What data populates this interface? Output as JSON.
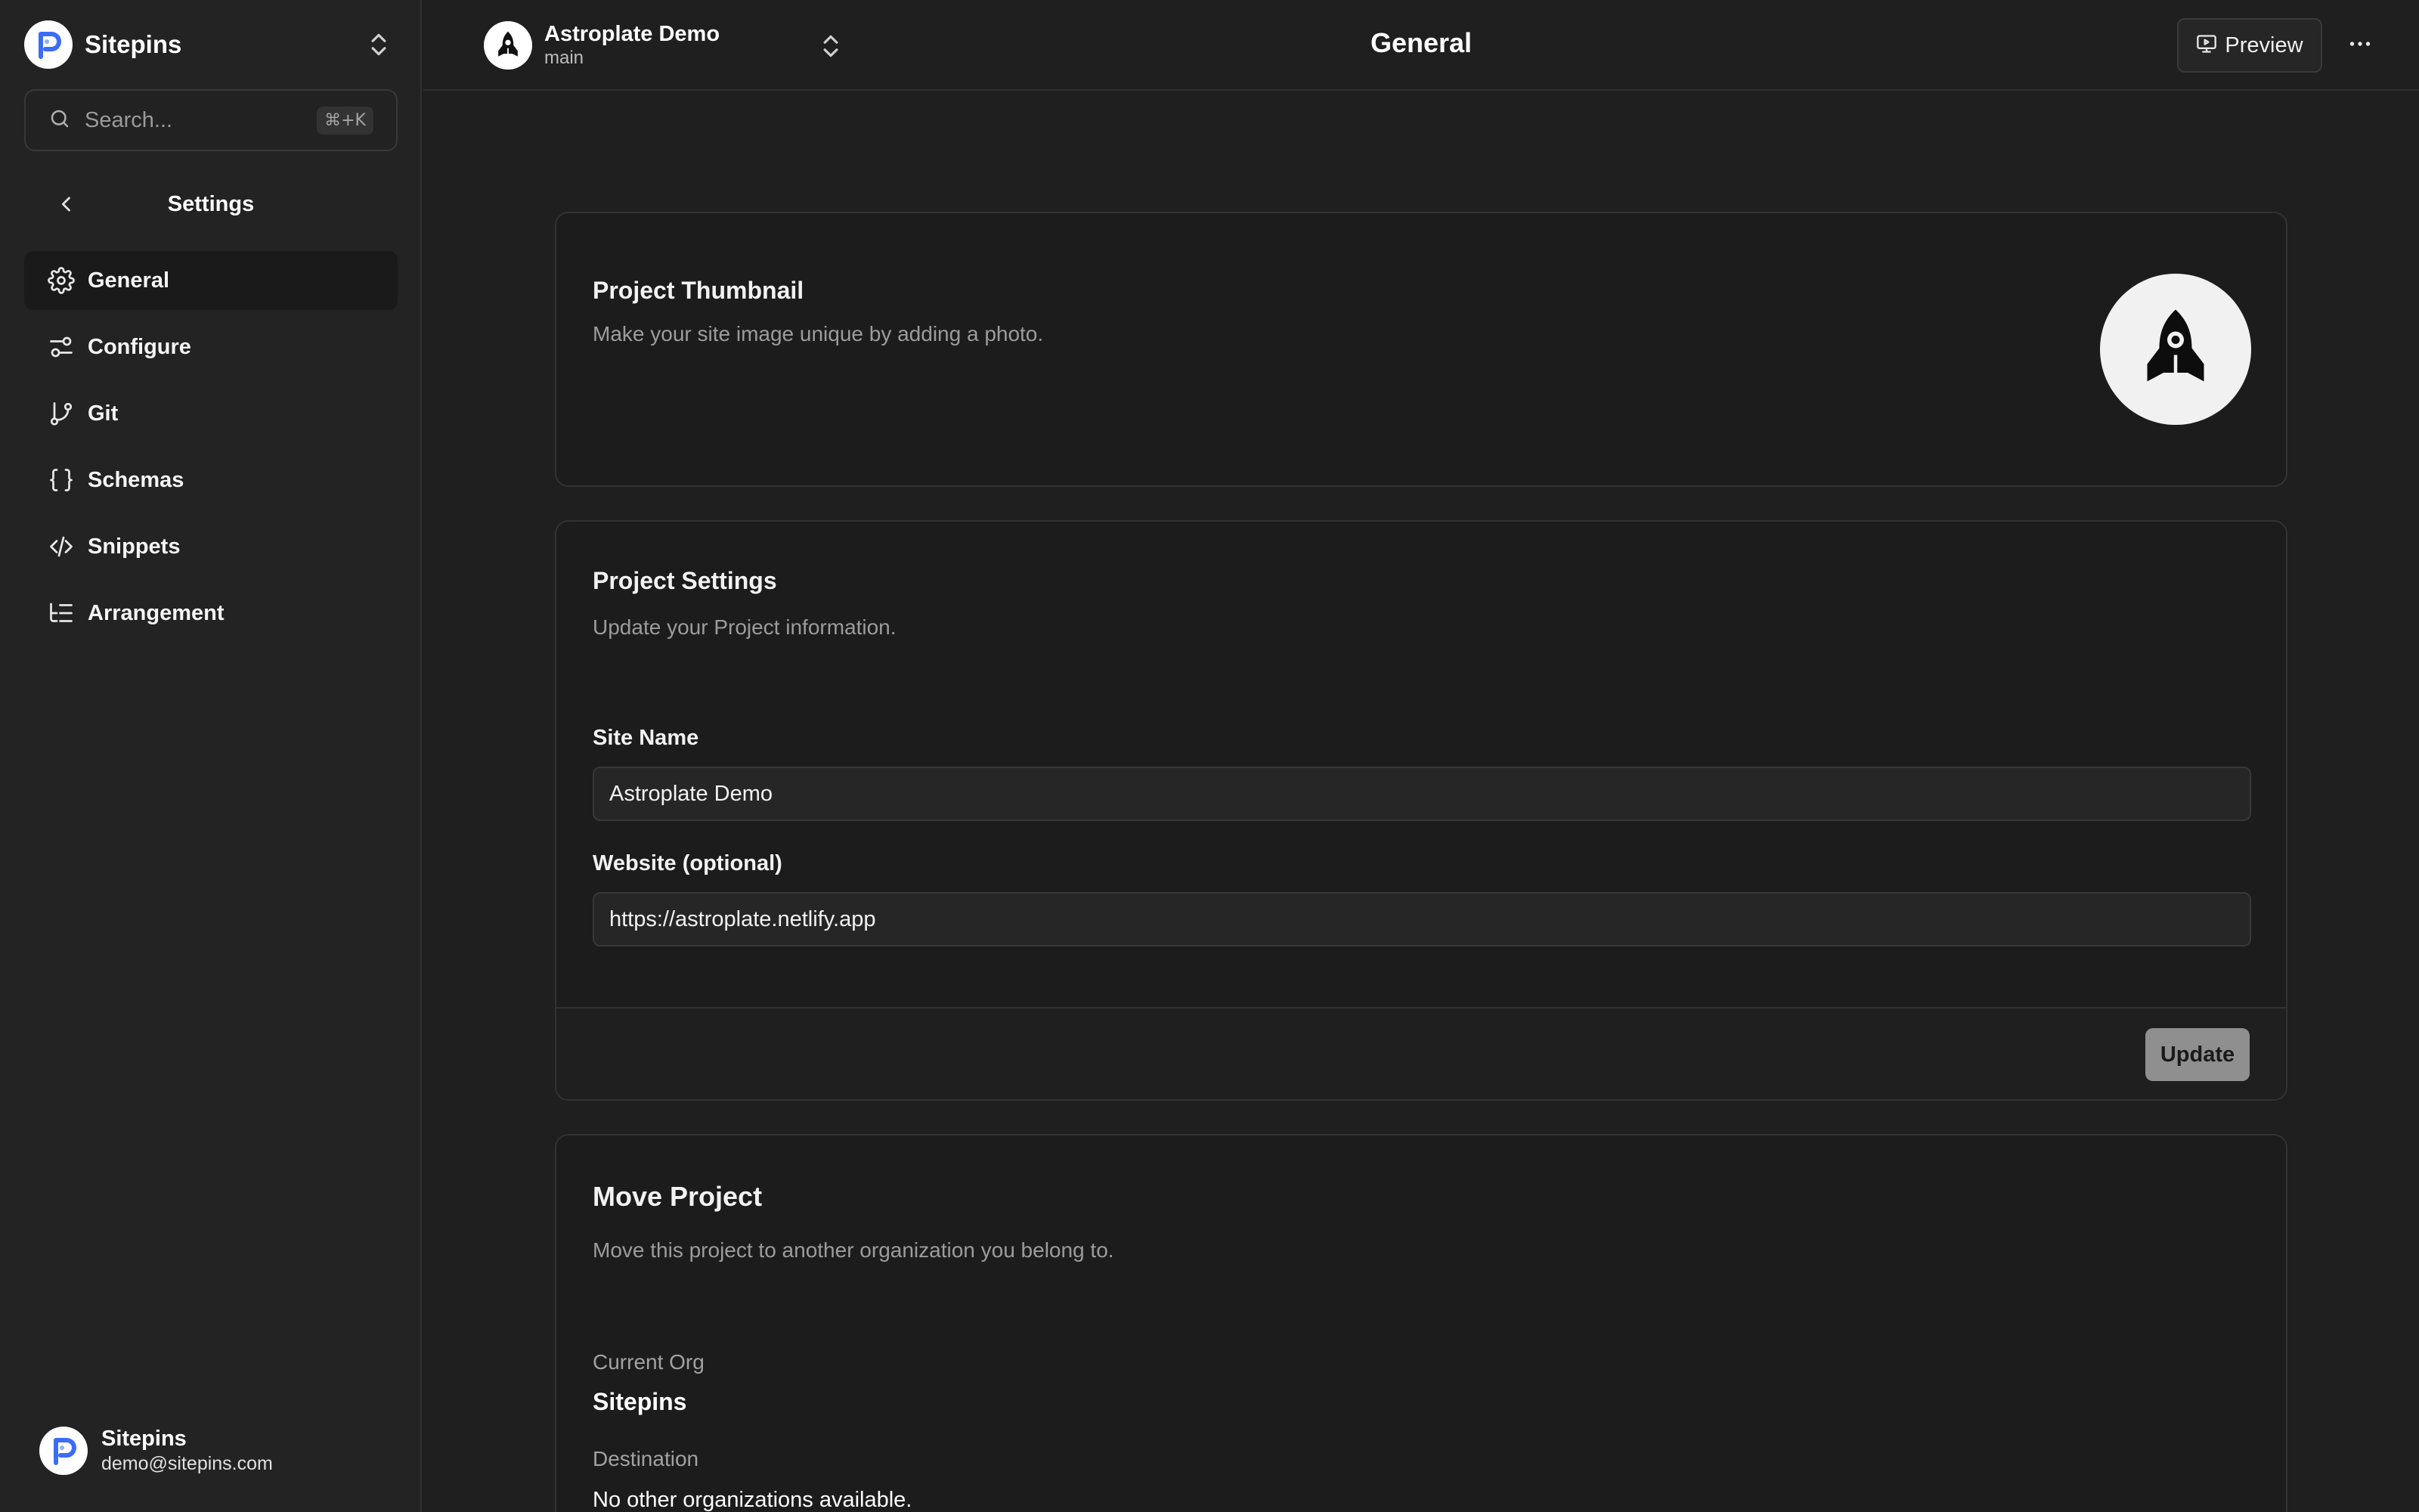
{
  "sidebar": {
    "brand": "Sitepins",
    "search_placeholder": "Search...",
    "search_shortcut": "⌘+K",
    "section_title": "Settings",
    "items": [
      {
        "label": "General",
        "icon": "gear-icon",
        "active": true
      },
      {
        "label": "Configure",
        "icon": "sliders-icon",
        "active": false
      },
      {
        "label": "Git",
        "icon": "git-branch-icon",
        "active": false
      },
      {
        "label": "Schemas",
        "icon": "braces-icon",
        "active": false
      },
      {
        "label": "Snippets",
        "icon": "code-icon",
        "active": false
      },
      {
        "label": "Arrangement",
        "icon": "list-tree-icon",
        "active": false
      }
    ],
    "user": {
      "name": "Sitepins",
      "email": "demo@sitepins.com"
    }
  },
  "topbar": {
    "project_name": "Astroplate Demo",
    "branch": "main",
    "page_title": "General",
    "preview_label": "Preview"
  },
  "thumbnail_card": {
    "title": "Project Thumbnail",
    "description": "Make your site image unique by adding a photo."
  },
  "settings_card": {
    "title": "Project Settings",
    "description": "Update your Project information.",
    "site_name_label": "Site Name",
    "site_name_value": "Astroplate Demo",
    "website_label": "Website (optional)",
    "website_value": "https://astroplate.netlify.app",
    "update_label": "Update"
  },
  "move_card": {
    "title": "Move Project",
    "description": "Move this project to another organization you belong to.",
    "current_org_label": "Current Org",
    "current_org_value": "Sitepins",
    "destination_label": "Destination",
    "destination_value": "No other organizations available."
  },
  "colors": {
    "background": "#1f1f1f",
    "sidebar": "#232323",
    "brand_accent": "#3b6cf6",
    "update_button": "#8f8f8f"
  }
}
